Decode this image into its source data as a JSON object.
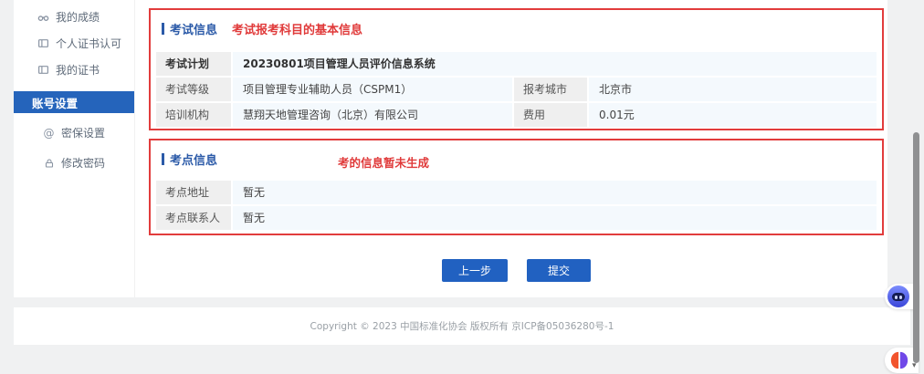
{
  "sidebar": {
    "items": [
      {
        "label": "我的成绩"
      },
      {
        "label": "个人证书认可"
      },
      {
        "label": "我的证书"
      },
      {
        "label": "账号设置"
      },
      {
        "label": "密保设置"
      },
      {
        "label": "修改密码"
      }
    ]
  },
  "exam_info": {
    "title": "考试信息",
    "note": "考试报考科目的基本信息",
    "plan_label": "考试计划",
    "plan_value": "20230801项目管理人员评价信息系统",
    "level_label": "考试等级",
    "level_value": "项目管理专业辅助人员（CSPM1）",
    "city_label": "报考城市",
    "city_value": "北京市",
    "org_label": "培训机构",
    "org_value": "慧翔天地管理咨询（北京）有限公司",
    "fee_label": "费用",
    "fee_value": "0.01元"
  },
  "site_info": {
    "title": "考点信息",
    "note": "考的信息暂未生成",
    "address_label": "考点地址",
    "address_value": "暂无",
    "contact_label": "考点联系人",
    "contact_value": "暂无"
  },
  "actions": {
    "prev": "上一步",
    "submit": "提交"
  },
  "footer": {
    "copyright": "Copyright © 2023 中国标准化协会 版权所有 京ICP备05036280号-1"
  },
  "colors": {
    "accent_blue": "#2161c1",
    "active_item_blue": "#2564bb",
    "title_blue": "#2b5aa8",
    "alert_red": "#e23c3c",
    "label_cell_bg": "#efefef",
    "value_cell_bg": "#f4f9fd"
  }
}
